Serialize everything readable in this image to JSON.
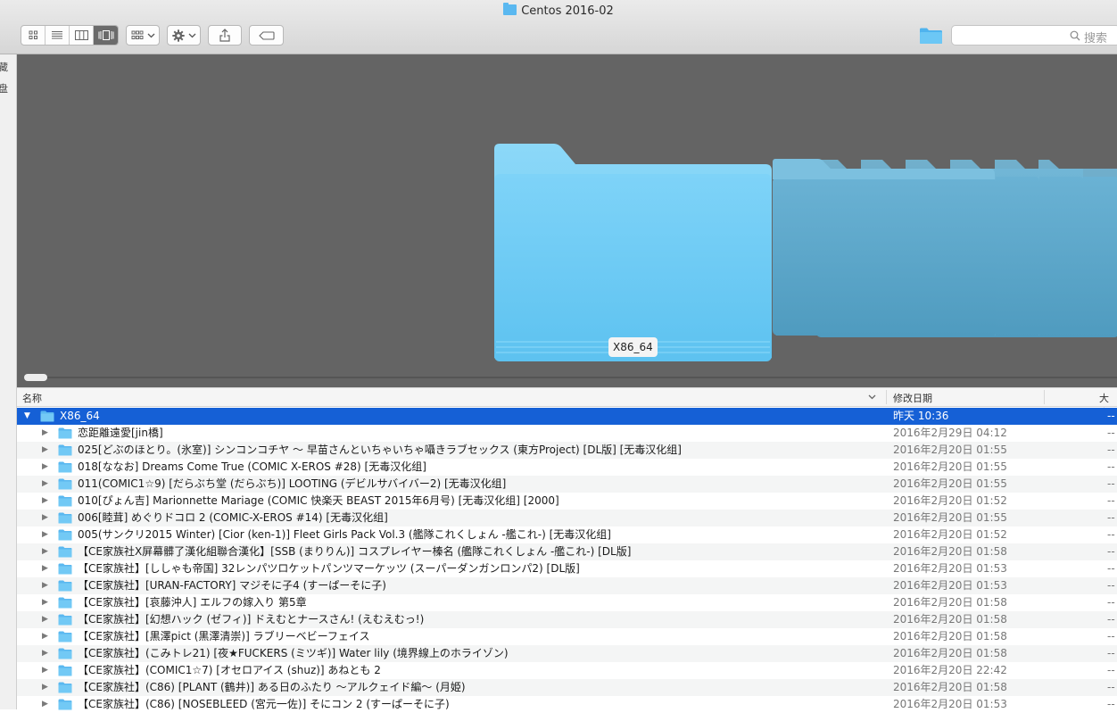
{
  "window": {
    "title": "Centos 2016-02"
  },
  "toolbar": {
    "search_placeholder": "搜索"
  },
  "sidebar": {
    "labels": [
      "藏",
      "盘"
    ]
  },
  "coverflow": {
    "selected_label": "X86_64"
  },
  "columns": {
    "name": "名称",
    "date": "修改日期",
    "size": "大小"
  },
  "rows": [
    {
      "name": "X86_64",
      "date": "昨天 10:36",
      "size": "--",
      "level": 0,
      "expanded": true,
      "selected": true
    },
    {
      "name": "恋距離遠愛[jin橋]",
      "date": "2016年2月29日 04:12",
      "size": "--",
      "level": 1
    },
    {
      "name": "025[どぶのほとり。(氷室)] シンコンコチヤ ～ 早苗さんといちゃいちゃ囁きラブセックス (東方Project) [DL版] [无毒汉化组]",
      "date": "2016年2月20日 01:55",
      "size": "--",
      "level": 1
    },
    {
      "name": "018[ななお] Dreams Come True (COMIC X-EROS #28) [无毒汉化组]",
      "date": "2016年2月20日 01:55",
      "size": "--",
      "level": 1
    },
    {
      "name": "011(COMIC1☆9) [だらぶち堂 (だらぶち)] LOOTING (デビルサバイバー2) [无毒汉化组]",
      "date": "2016年2月20日 01:55",
      "size": "--",
      "level": 1
    },
    {
      "name": "010[ぴょん吉] Marionnette Mariage (COMIC 快楽天 BEAST 2015年6月号) [无毒汉化组] [2000]",
      "date": "2016年2月20日 01:52",
      "size": "--",
      "level": 1
    },
    {
      "name": "006[睦茸] めぐりドコロ 2 (COMIC-X-EROS #14) [无毒汉化组]",
      "date": "2016年2月20日 01:55",
      "size": "--",
      "level": 1
    },
    {
      "name": "005(サンクリ2015 Winter) [Cior (ken-1)] Fleet Girls Pack Vol.3 (艦隊これくしょん -艦これ-) [无毒汉化组]",
      "date": "2016年2月20日 01:52",
      "size": "--",
      "level": 1
    },
    {
      "name": "【CE家族社X屏幕髒了漢化組聯合漢化】[SSB (まりりん)] コスプレイヤー榛名 (艦隊これくしょん -艦これ-) [DL版]",
      "date": "2016年2月20日 01:58",
      "size": "--",
      "level": 1
    },
    {
      "name": "【CE家族社】[ししゃも帝国] 32レンパツロケットパンツマーケッツ (スーパーダンガンロンパ2) [DL版]",
      "date": "2016年2月20日 01:53",
      "size": "--",
      "level": 1
    },
    {
      "name": "【CE家族社】[URAN-FACTORY] マジそに子4 (すーぱーそに子)",
      "date": "2016年2月20日 01:53",
      "size": "--",
      "level": 1
    },
    {
      "name": "【CE家族社】[哀藤沖人] エルフの嫁入り 第5章",
      "date": "2016年2月20日 01:58",
      "size": "--",
      "level": 1
    },
    {
      "name": "【CE家族社】[幻想ハック (ゼフィ)] ドえむとナースさん! (えむえむっ!)",
      "date": "2016年2月20日 01:58",
      "size": "--",
      "level": 1
    },
    {
      "name": "【CE家族社】[黒澤pict (黒澤清崇)] ラブリーベビーフェイス",
      "date": "2016年2月20日 01:58",
      "size": "--",
      "level": 1
    },
    {
      "name": "【CE家族社】(こみトレ21) [夜★FUCKERS (ミツギ)] Water lily (境界線上のホライゾン)",
      "date": "2016年2月20日 01:58",
      "size": "--",
      "level": 1
    },
    {
      "name": "【CE家族社】(COMIC1☆7) [オセロアイス (shuz)] あねとも 2",
      "date": "2016年2月20日 22:42",
      "size": "--",
      "level": 1
    },
    {
      "name": "【CE家族社】(C86) [PLANT (鶴井)] ある日のふたり ～アルクェイド編～ (月姫)",
      "date": "2016年2月20日 01:58",
      "size": "--",
      "level": 1
    },
    {
      "name": "【CE家族社】(C86) [NOSEBLEED (宮元一佐)] そにコン 2 (すーぱーそに子)",
      "date": "2016年2月20日 01:53",
      "size": "--",
      "level": 1
    }
  ],
  "colors": {
    "selection": "#1560d6",
    "folder": "#5ab8f0",
    "coverflow_bg": "#646464"
  }
}
